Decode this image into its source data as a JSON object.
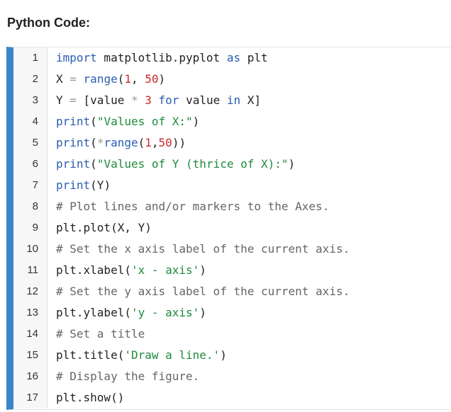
{
  "heading": "Python Code:",
  "lines": [
    {
      "no": "1",
      "tokens": [
        [
          "kw",
          "import"
        ],
        [
          "pl",
          " matplotlib.pyplot "
        ],
        [
          "kw",
          "as"
        ],
        [
          "pl",
          " plt"
        ]
      ]
    },
    {
      "no": "2",
      "tokens": [
        [
          "pl",
          "X "
        ],
        [
          "op",
          "="
        ],
        [
          "pl",
          " "
        ],
        [
          "fn",
          "range"
        ],
        [
          "pl",
          "("
        ],
        [
          "num",
          "1"
        ],
        [
          "pl",
          ", "
        ],
        [
          "num",
          "50"
        ],
        [
          "pl",
          ")"
        ]
      ]
    },
    {
      "no": "3",
      "tokens": [
        [
          "pl",
          "Y "
        ],
        [
          "op",
          "="
        ],
        [
          "pl",
          " [value "
        ],
        [
          "op",
          "*"
        ],
        [
          "pl",
          " "
        ],
        [
          "num",
          "3"
        ],
        [
          "pl",
          " "
        ],
        [
          "kw",
          "for"
        ],
        [
          "pl",
          " value "
        ],
        [
          "kw",
          "in"
        ],
        [
          "pl",
          " X]"
        ]
      ]
    },
    {
      "no": "4",
      "tokens": [
        [
          "fn",
          "print"
        ],
        [
          "pl",
          "("
        ],
        [
          "str",
          "\"Values of X:\""
        ],
        [
          "pl",
          ")"
        ]
      ]
    },
    {
      "no": "5",
      "tokens": [
        [
          "fn",
          "print"
        ],
        [
          "pl",
          "("
        ],
        [
          "op",
          "*"
        ],
        [
          "fn",
          "range"
        ],
        [
          "pl",
          "("
        ],
        [
          "num",
          "1"
        ],
        [
          "pl",
          ","
        ],
        [
          "num",
          "50"
        ],
        [
          "pl",
          "))"
        ]
      ]
    },
    {
      "no": "6",
      "tokens": [
        [
          "fn",
          "print"
        ],
        [
          "pl",
          "("
        ],
        [
          "str",
          "\"Values of Y (thrice of X):\""
        ],
        [
          "pl",
          ")"
        ]
      ]
    },
    {
      "no": "7",
      "tokens": [
        [
          "fn",
          "print"
        ],
        [
          "pl",
          "(Y)"
        ]
      ]
    },
    {
      "no": "8",
      "tokens": [
        [
          "cm",
          "# Plot lines and/or markers to the Axes."
        ]
      ]
    },
    {
      "no": "9",
      "tokens": [
        [
          "pl",
          "plt.plot(X, Y)"
        ]
      ]
    },
    {
      "no": "10",
      "tokens": [
        [
          "cm",
          "# Set the x axis label of the current axis."
        ]
      ]
    },
    {
      "no": "11",
      "tokens": [
        [
          "pl",
          "plt.xlabel("
        ],
        [
          "str",
          "'x - axis'"
        ],
        [
          "pl",
          ")"
        ]
      ]
    },
    {
      "no": "12",
      "tokens": [
        [
          "cm",
          "# Set the y axis label of the current axis."
        ]
      ]
    },
    {
      "no": "13",
      "tokens": [
        [
          "pl",
          "plt.ylabel("
        ],
        [
          "str",
          "'y - axis'"
        ],
        [
          "pl",
          ")"
        ]
      ]
    },
    {
      "no": "14",
      "tokens": [
        [
          "cm",
          "# Set a title"
        ]
      ]
    },
    {
      "no": "15",
      "tokens": [
        [
          "pl",
          "plt.title("
        ],
        [
          "str",
          "'Draw a line.'"
        ],
        [
          "pl",
          ")"
        ]
      ]
    },
    {
      "no": "16",
      "tokens": [
        [
          "cm",
          "# Display the figure."
        ]
      ]
    },
    {
      "no": "17",
      "tokens": [
        [
          "pl",
          "plt.show()"
        ]
      ]
    }
  ]
}
